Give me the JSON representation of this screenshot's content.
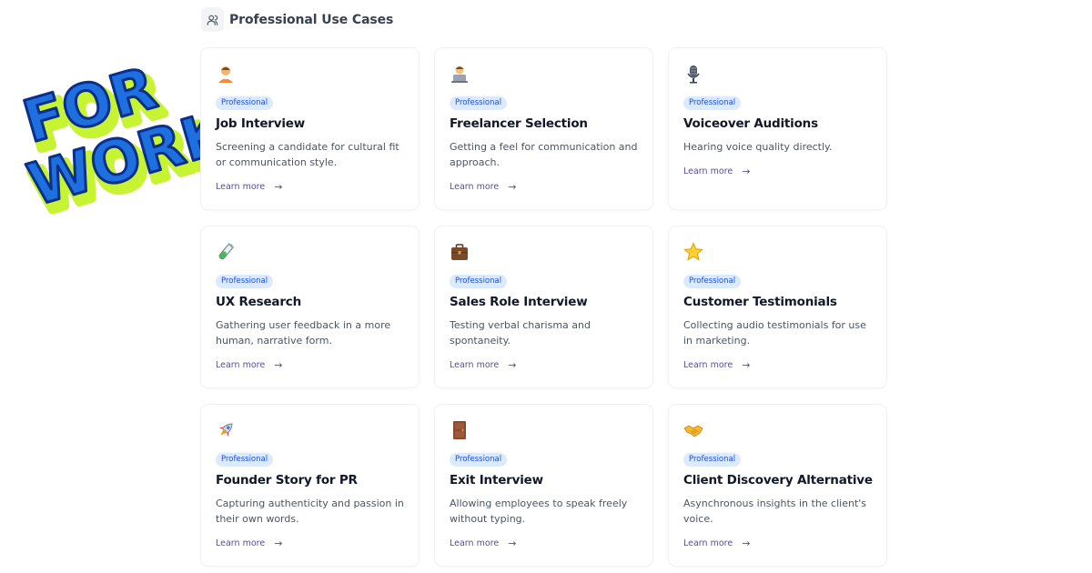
{
  "section": {
    "icon": "users-icon",
    "title": "Professional Use Cases"
  },
  "sticker": {
    "line1": "FOR",
    "line2": "WORK",
    "colors": {
      "fill": "#1e6fe0",
      "outline": "#0b2f8a",
      "shadow": "#c6f432"
    }
  },
  "colors": {
    "badge_bg": "#dbeafe",
    "badge_text": "#1d4ed8",
    "link": "#5b4b9a"
  },
  "cards": [
    {
      "icon": "office-worker-icon",
      "badge": "Professional",
      "title": "Job Interview",
      "description": "Screening a candidate for cultural fit or communication style.",
      "link": "Learn more"
    },
    {
      "icon": "technologist-icon",
      "badge": "Professional",
      "title": "Freelancer Selection",
      "description": "Getting a feel for communication and approach.",
      "link": "Learn more"
    },
    {
      "icon": "microphone-icon",
      "badge": "Professional",
      "title": "Voiceover Auditions",
      "description": "Hearing voice quality directly.",
      "link": "Learn more"
    },
    {
      "icon": "test-tube-icon",
      "badge": "Professional",
      "title": "UX Research",
      "description": "Gathering user feedback in a more human, narrative form.",
      "link": "Learn more"
    },
    {
      "icon": "briefcase-icon",
      "badge": "Professional",
      "title": "Sales Role Interview",
      "description": "Testing verbal charisma and spontaneity.",
      "link": "Learn more"
    },
    {
      "icon": "star-icon",
      "badge": "Professional",
      "title": "Customer Testimonials",
      "description": "Collecting audio testimonials for use in marketing.",
      "link": "Learn more"
    },
    {
      "icon": "rocket-icon",
      "badge": "Professional",
      "title": "Founder Story for PR",
      "description": "Capturing authenticity and passion in their own words.",
      "link": "Learn more"
    },
    {
      "icon": "door-icon",
      "badge": "Professional",
      "title": "Exit Interview",
      "description": "Allowing employees to speak freely without typing.",
      "link": "Learn more"
    },
    {
      "icon": "handshake-icon",
      "badge": "Professional",
      "title": "Client Discovery Alternative",
      "description": "Asynchronous insights in the client's voice.",
      "link": "Learn more"
    }
  ]
}
